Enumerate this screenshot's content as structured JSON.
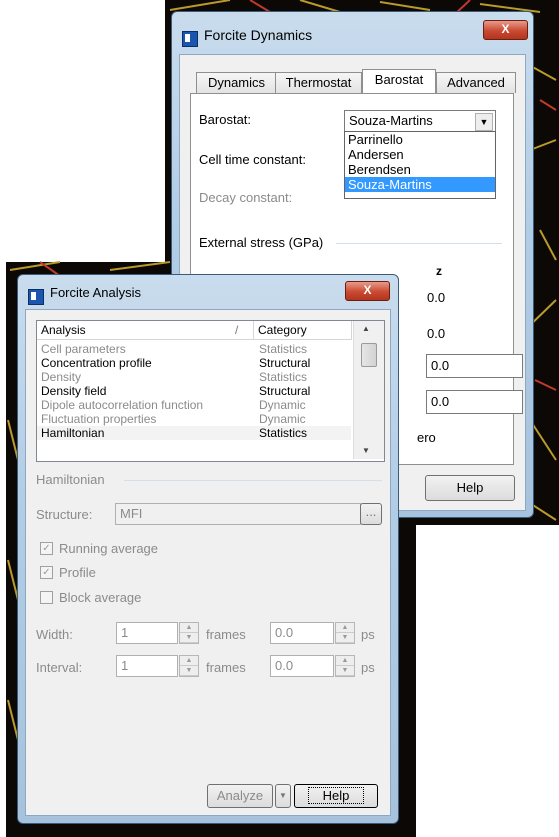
{
  "dynamics_window": {
    "title": "Forcite Dynamics",
    "close_label": "X",
    "tabs": [
      {
        "label": "Dynamics"
      },
      {
        "label": "Thermostat"
      },
      {
        "label": "Barostat"
      },
      {
        "label": "Advanced"
      }
    ],
    "active_tab": "Barostat",
    "barostat_label": "Barostat:",
    "barostat_value": "Souza-Martins",
    "barostat_options": [
      "Parrinello",
      "Andersen",
      "Berendsen",
      "Souza-Martins"
    ],
    "cell_time_constant_label": "Cell time constant:",
    "decay_constant_label": "Decay constant:",
    "external_stress_label": "External stress (GPa)",
    "z_header": "z",
    "stress_values": [
      "0.0",
      "0.0",
      "0.0",
      "0.0"
    ],
    "partial_text": "ero",
    "help_label": "Help"
  },
  "analysis_window": {
    "title": "Forcite Analysis",
    "close_label": "X",
    "columns": {
      "analysis": "Analysis",
      "sort_marker": "/",
      "category": "Category"
    },
    "rows": [
      {
        "analysis": "Cell parameters",
        "category": "Statistics",
        "enabled": false
      },
      {
        "analysis": "Concentration profile",
        "category": "Structural",
        "enabled": true
      },
      {
        "analysis": "Density",
        "category": "Statistics",
        "enabled": false
      },
      {
        "analysis": "Density field",
        "category": "Structural",
        "enabled": true
      },
      {
        "analysis": "Dipole autocorrelation function",
        "category": "Dynamic",
        "enabled": false
      },
      {
        "analysis": "Fluctuation properties",
        "category": "Dynamic",
        "enabled": false
      },
      {
        "analysis": "Hamiltonian",
        "category": "Statistics",
        "enabled": true
      }
    ],
    "group_label": "Hamiltonian",
    "structure_label": "Structure:",
    "structure_value": "MFI",
    "browse_label": "...",
    "running_average_label": "Running average",
    "profile_label": "Profile",
    "block_average_label": "Block average",
    "width_label": "Width:",
    "width_value": "1",
    "interval_label": "Interval:",
    "interval_value": "1",
    "frames_label": "frames",
    "time_value_1": "0.0",
    "time_value_2": "0.0",
    "ps_label": "ps",
    "analyze_label": "Analyze",
    "help_label": "Help"
  }
}
